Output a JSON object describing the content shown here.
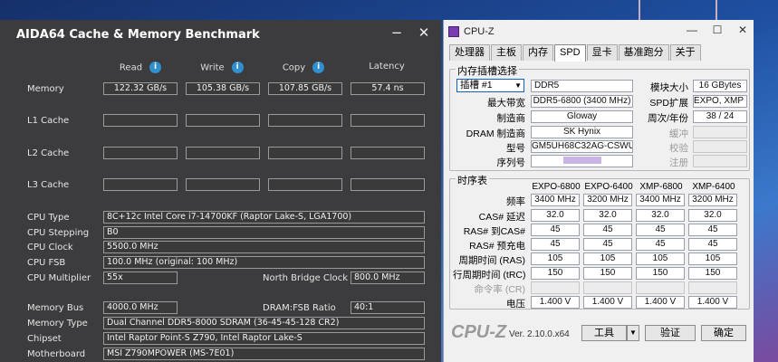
{
  "aida": {
    "title": "AIDA64 Cache & Memory Benchmark",
    "minimize": "−",
    "close": "✕",
    "headers": [
      "Read",
      "Write",
      "Copy",
      "Latency"
    ],
    "rows": [
      {
        "label": "Memory",
        "values": [
          "122.32 GB/s",
          "105.38 GB/s",
          "107.85 GB/s",
          "57.4 ns"
        ]
      },
      {
        "label": "L1 Cache",
        "values": [
          "",
          "",
          "",
          ""
        ]
      },
      {
        "label": "L2 Cache",
        "values": [
          "",
          "",
          "",
          ""
        ]
      },
      {
        "label": "L3 Cache",
        "values": [
          "",
          "",
          "",
          ""
        ]
      }
    ],
    "cpu_type": {
      "label": "CPU Type",
      "value": "8C+12c Intel Core i7-14700KF  (Raptor Lake-S, LGA1700)"
    },
    "cpu_stepping": {
      "label": "CPU Stepping",
      "value": "B0"
    },
    "cpu_clock": {
      "label": "CPU Clock",
      "value": "5500.0 MHz"
    },
    "cpu_fsb": {
      "label": "CPU FSB",
      "value": "100.0 MHz  (original: 100 MHz)"
    },
    "cpu_multiplier": {
      "label": "CPU Multiplier",
      "value": "55x"
    },
    "nb_clock": {
      "label": "North Bridge Clock",
      "value": "800.0 MHz"
    },
    "memory_bus": {
      "label": "Memory Bus",
      "value": "4000.0 MHz"
    },
    "dram_fsb": {
      "label": "DRAM:FSB Ratio",
      "value": "40:1"
    },
    "memory_type": {
      "label": "Memory Type",
      "value": "Dual Channel DDR5-8000 SDRAM  (36-45-45-128 CR2)"
    },
    "chipset": {
      "label": "Chipset",
      "value": "Intel Raptor Point-S Z790, Intel Raptor Lake-S"
    },
    "motherboard": {
      "label": "Motherboard",
      "value": "MSI Z790MPOWER (MS-7E01)"
    }
  },
  "cpuz": {
    "title": "CPU-Z",
    "minimize": "—",
    "maximize": "☐",
    "close": "✕",
    "tabs": [
      "处理器",
      "主板",
      "内存",
      "SPD",
      "显卡",
      "基准跑分",
      "关于"
    ],
    "slot_group": "内存插槽选择",
    "slot_select": "插槽 #1",
    "ddr": "DDR5",
    "module_size_label": "模块大小",
    "module_size": "16 GBytes",
    "max_bw_label": "最大带宽",
    "max_bw": "DDR5-6800 (3400 MHz)",
    "spd_ext_label": "SPD扩展",
    "spd_ext": "EXPO, XMP 3.0",
    "manufacturer_label": "制造商",
    "manufacturer": "Gloway",
    "week_year_label": "周次/年份",
    "week_year": "38 / 24",
    "dram_mfr_label": "DRAM 制造商",
    "dram_mfr": "SK Hynix",
    "buffered_label": "缓冲",
    "part_label": "型号",
    "part": "GM5UH68C32AG-CSWURA",
    "correction_label": "校验",
    "serial_label": "序列号",
    "serial": "",
    "registered_label": "注册",
    "timing_group": "时序表",
    "timing_headers": [
      "EXPO-6800",
      "EXPO-6400",
      "XMP-6800",
      "XMP-6400"
    ],
    "timing_rows": [
      {
        "label": "频率",
        "values": [
          "3400 MHz",
          "3200 MHz",
          "3400 MHz",
          "3200 MHz"
        ]
      },
      {
        "label": "CAS# 延迟",
        "values": [
          "32.0",
          "32.0",
          "32.0",
          "32.0"
        ]
      },
      {
        "label": "RAS# 到CAS#",
        "values": [
          "45",
          "45",
          "45",
          "45"
        ]
      },
      {
        "label": "RAS# 预充电",
        "values": [
          "45",
          "45",
          "45",
          "45"
        ]
      },
      {
        "label": "周期时间 (RAS)",
        "values": [
          "105",
          "105",
          "105",
          "105"
        ]
      },
      {
        "label": "行周期时间 (tRC)",
        "values": [
          "150",
          "150",
          "150",
          "150"
        ]
      },
      {
        "label": "命令率 (CR)",
        "values": [
          "",
          "",
          "",
          ""
        ]
      },
      {
        "label": "电压",
        "values": [
          "1.400 V",
          "1.400 V",
          "1.400 V",
          "1.400 V"
        ]
      }
    ],
    "logo": "CPU-Z",
    "version": "Ver. 2.10.0.x64",
    "tools": "工具",
    "validate": "验证",
    "ok": "确定"
  },
  "colors": {
    "aida_bg": "#3c3c3e",
    "accent": "#2f8fcf",
    "cpuz_purple": "#7a3db0"
  }
}
